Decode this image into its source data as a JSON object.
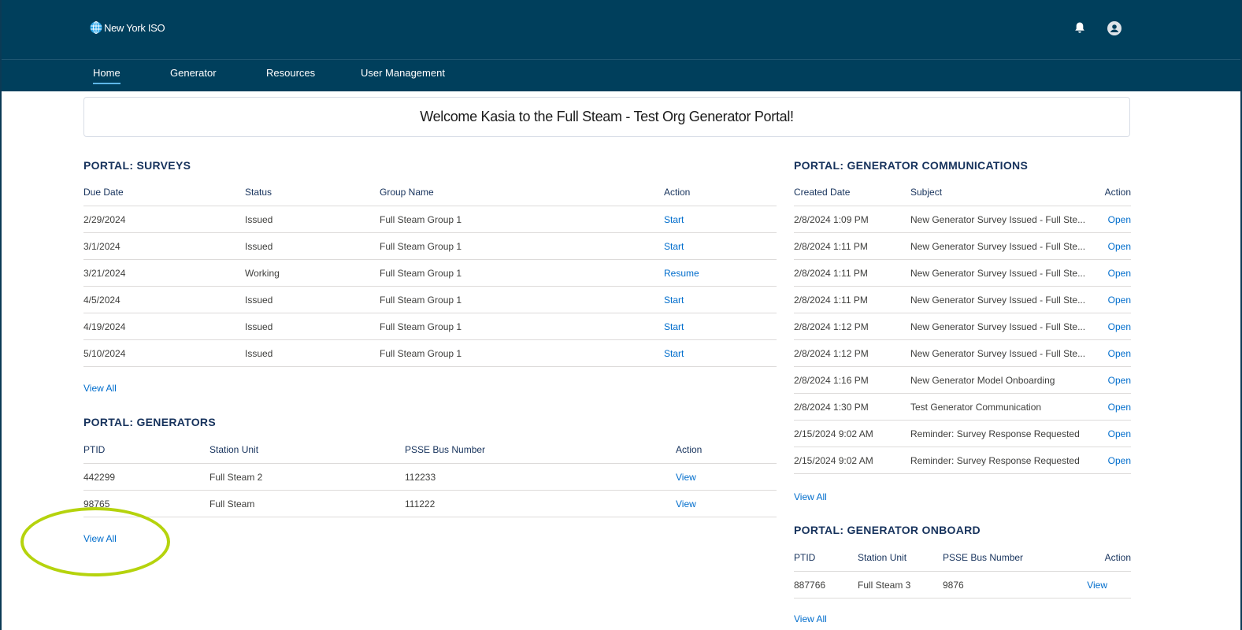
{
  "header": {
    "logo_text": "New York ISO",
    "icons": [
      "globe-logo-icon",
      "bell-icon",
      "user-avatar-icon"
    ],
    "brand_color": "#003f5c"
  },
  "nav": {
    "items": [
      {
        "label": "Home",
        "active": true
      },
      {
        "label": "Generator",
        "active": false
      },
      {
        "label": "Resources",
        "active": false
      },
      {
        "label": "User Management",
        "active": false
      }
    ]
  },
  "welcome": "Welcome Kasia to the Full Steam - Test Org Generator Portal!",
  "surveys": {
    "title": "PORTAL: SURVEYS",
    "columns": [
      "Due Date",
      "Status",
      "Group Name",
      "Action"
    ],
    "rows": [
      [
        "2/29/2024",
        "Issued",
        "Full Steam Group 1",
        "Start"
      ],
      [
        "3/1/2024",
        "Issued",
        "Full Steam Group 1",
        "Start"
      ],
      [
        "3/21/2024",
        "Working",
        "Full Steam Group 1",
        "Resume"
      ],
      [
        "4/5/2024",
        "Issued",
        "Full Steam Group 1",
        "Start"
      ],
      [
        "4/19/2024",
        "Issued",
        "Full Steam Group 1",
        "Start"
      ],
      [
        "5/10/2024",
        "Issued",
        "Full Steam Group 1",
        "Start"
      ]
    ],
    "view_all": "View All"
  },
  "generators": {
    "title": "PORTAL: GENERATORS",
    "columns": [
      "PTID",
      "Station Unit",
      "PSSE Bus Number",
      "Action"
    ],
    "rows": [
      [
        "442299",
        "Full Steam 2",
        "112233",
        "View"
      ],
      [
        "98765",
        "Full Steam",
        "111222",
        "View"
      ]
    ],
    "view_all": "View All"
  },
  "communications": {
    "title": "PORTAL: GENERATOR COMMUNICATIONS",
    "columns": [
      "Created Date",
      "Subject",
      "Action"
    ],
    "rows": [
      [
        "2/8/2024 1:09 PM",
        "New Generator Survey Issued - Full Ste...",
        "Open"
      ],
      [
        "2/8/2024 1:11 PM",
        "New Generator Survey Issued - Full Ste...",
        "Open"
      ],
      [
        "2/8/2024 1:11 PM",
        "New Generator Survey Issued - Full Ste...",
        "Open"
      ],
      [
        "2/8/2024 1:11 PM",
        "New Generator Survey Issued - Full Ste...",
        "Open"
      ],
      [
        "2/8/2024 1:12 PM",
        "New Generator Survey Issued - Full Ste...",
        "Open"
      ],
      [
        "2/8/2024 1:12 PM",
        "New Generator Survey Issued - Full Ste...",
        "Open"
      ],
      [
        "2/8/2024 1:16 PM",
        "New Generator Model Onboarding",
        "Open"
      ],
      [
        "2/8/2024 1:30 PM",
        "Test Generator Communication",
        "Open"
      ],
      [
        "2/15/2024 9:02 AM",
        "Reminder: Survey Response Requested",
        "Open"
      ],
      [
        "2/15/2024 9:02 AM",
        "Reminder: Survey Response Requested",
        "Open"
      ]
    ],
    "view_all": "View All"
  },
  "onboard": {
    "title": "PORTAL: GENERATOR ONBOARD",
    "columns": [
      "PTID",
      "Station Unit",
      "PSSE Bus Number",
      "Action"
    ],
    "rows": [
      [
        "887766",
        "Full Steam 3",
        "9876",
        "View"
      ]
    ],
    "view_all": "View All"
  },
  "annotation_color": "#b5d30d"
}
